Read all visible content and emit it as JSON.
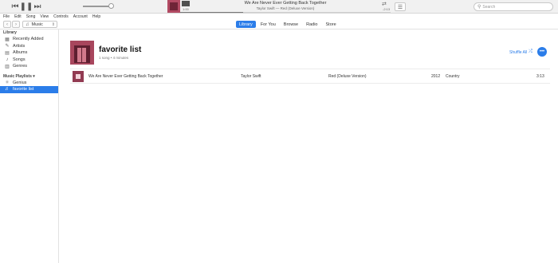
{
  "player": {
    "now_playing_title": "We Are Never Ever Getting Back Together",
    "now_playing_subtitle": "Taylor Swift — Red (Deluxe Version)",
    "time_elapsed": "1:00",
    "time_remaining": "-2:13",
    "progress_fraction": 0.3,
    "search_placeholder": "Search"
  },
  "menu": [
    "File",
    "Edit",
    "Song",
    "View",
    "Controls",
    "Account",
    "Help"
  ],
  "nav": {
    "media_type": "Music",
    "tabs": [
      {
        "label": "Library",
        "active": true
      },
      {
        "label": "For You",
        "active": false
      },
      {
        "label": "Browse",
        "active": false
      },
      {
        "label": "Radio",
        "active": false
      },
      {
        "label": "Store",
        "active": false
      }
    ]
  },
  "sidebar": {
    "library_header": "Library",
    "library_items": [
      {
        "label": "Recently Added",
        "icon": "recently-added-icon"
      },
      {
        "label": "Artists",
        "icon": "artists-icon"
      },
      {
        "label": "Albums",
        "icon": "albums-icon"
      },
      {
        "label": "Songs",
        "icon": "songs-icon"
      },
      {
        "label": "Genres",
        "icon": "genres-icon"
      }
    ],
    "playlists_header": "Music Playlists ▾",
    "playlist_items": [
      {
        "label": "Genius",
        "icon": "genius-icon",
        "active": false
      },
      {
        "label": "favorite list",
        "icon": "playlist-icon",
        "active": true
      }
    ]
  },
  "playlist": {
    "title": "favorite list",
    "subtitle": "1 song • 4 minutes",
    "shuffle_label": "Shuffle All",
    "accent_color": "#2b7de9"
  },
  "songs": [
    {
      "title": "We Are Never Ever Getting Back Together",
      "artist": "Taylor Swift",
      "album": "Red (Deluxe Version)",
      "year": "2012",
      "genre": "Country",
      "time": "3:13"
    }
  ]
}
